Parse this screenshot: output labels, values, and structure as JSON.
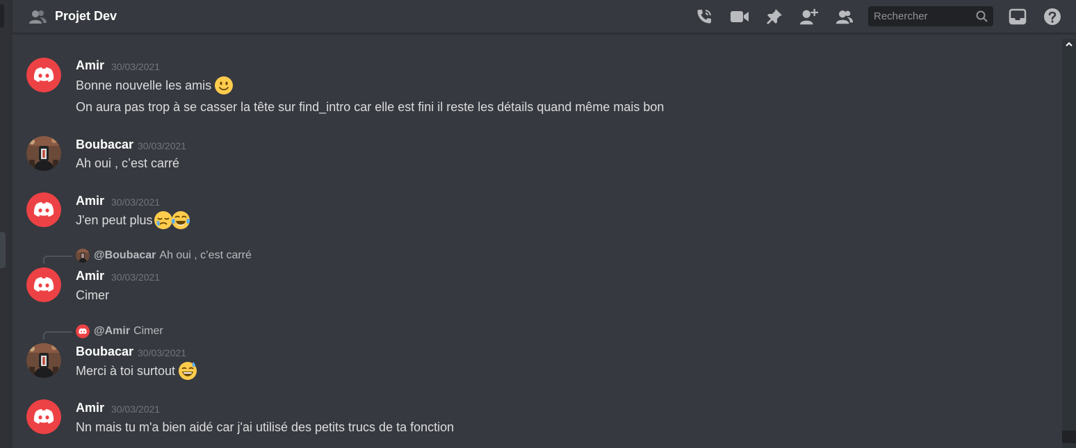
{
  "header": {
    "title": "Projet Dev",
    "search_placeholder": "Rechercher",
    "icons": [
      "group-icon",
      "call-icon",
      "video-icon",
      "pin-icon",
      "add-member-icon",
      "members-icon",
      "search-icon",
      "inbox-icon",
      "help-icon"
    ]
  },
  "colors": {
    "background": "#36393f",
    "header": "#36393f",
    "discord_red": "#ed4245",
    "text": "#dcddde",
    "timestamp": "#72767d"
  },
  "messages": [
    {
      "author": "Amir",
      "timestamp": "30/03/2021",
      "avatar": "discord-logo",
      "lines": [
        {
          "text": "Bonne nouvelle les amis",
          "emoji": [
            "slightly-smiling-face"
          ]
        },
        {
          "text": "On aura pas trop à se casser la tête sur find_intro car elle est fini il reste les détails quand même mais bon",
          "emoji": []
        }
      ]
    },
    {
      "author": "Boubacar",
      "timestamp": "30/03/2021",
      "avatar": "user-photo",
      "lines": [
        {
          "text": "Ah oui , c’est carré",
          "emoji": []
        }
      ]
    },
    {
      "author": "Amir",
      "timestamp": "30/03/2021",
      "avatar": "discord-logo",
      "lines": [
        {
          "text": "J'en peut plus",
          "emoji": [
            "crying-face",
            "tears-of-joy"
          ]
        }
      ]
    },
    {
      "reply": {
        "mention": "@Boubacar",
        "text": "Ah oui , c’est carré"
      },
      "author": "Amir",
      "timestamp": "30/03/2021",
      "avatar": "discord-logo",
      "lines": [
        {
          "text": "Cimer",
          "emoji": []
        }
      ]
    },
    {
      "reply": {
        "mention": "@Amir",
        "text": "Cimer"
      },
      "author": "Boubacar",
      "timestamp": "30/03/2021",
      "avatar": "user-photo",
      "lines": [
        {
          "text": "Merci à toi surtout",
          "emoji": [
            "grinning-sweat"
          ]
        }
      ]
    },
    {
      "author": "Amir",
      "timestamp": "30/03/2021",
      "avatar": "discord-logo",
      "lines": [
        {
          "text": "Nn mais tu m'a bien aidé car j'ai utilisé des petits trucs de ta fonction",
          "emoji": []
        }
      ]
    }
  ]
}
